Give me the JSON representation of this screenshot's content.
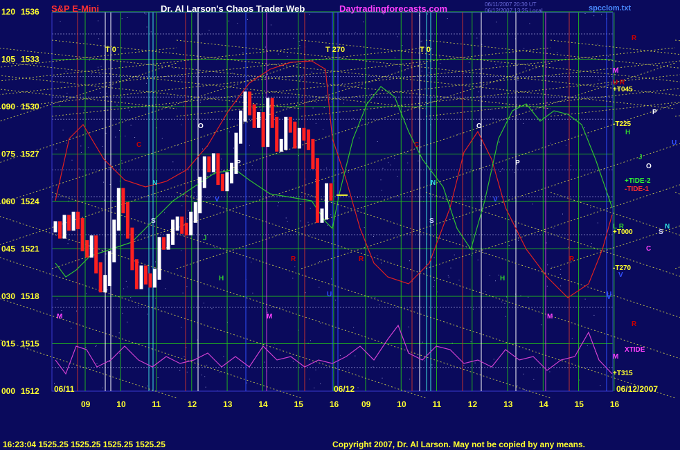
{
  "header": {
    "symbol": "S&P E-Mini",
    "title": "Dr. Al Larson's Chaos Trader Web",
    "website": "Daytradingforecasts.com",
    "timestamp_1": "06/11/2007 20:30 UT",
    "timestamp_2": "06/12/2007 13:25 Local",
    "filename": "spcclom.txt"
  },
  "footer": {
    "quote": "16:23:04  1525.25 1525.25 1525.25 1525.25",
    "copyright": "Copyright 2007, Dr. Al Larson. May not be copied by any means."
  },
  "colors": {
    "background": "#0a0a5c",
    "price_up": "#ffffff",
    "price_down": "#ff2020",
    "grid_green": "#20b020",
    "grid_yellow": "#e8e84a",
    "red_wave": "#e02020",
    "green_wave": "#30c030",
    "magenta_wave": "#d040d0",
    "title_red": "#ff3030",
    "title_white": "#ffffff",
    "title_magenta": "#ff40ff",
    "axis_yellow": "#ffff30"
  },
  "chart_data": {
    "type": "line",
    "y_axis_labels": [
      {
        "left": "120",
        "right": "1536"
      },
      {
        "left": "105",
        "right": "1533"
      },
      {
        "left": "090",
        "right": "1530"
      },
      {
        "left": "075",
        "right": "1527"
      },
      {
        "left": "060",
        "right": "1524"
      },
      {
        "left": "045",
        "right": "1521"
      },
      {
        "left": "030",
        "right": "1518"
      },
      {
        "left": "015",
        "right": "1515"
      },
      {
        "left": "000",
        "right": "1512"
      }
    ],
    "ylim": [
      1512,
      1536
    ],
    "x_hour_ticks": [
      "09",
      "10",
      "11",
      "12",
      "13",
      "14",
      "15",
      "16",
      "09",
      "10",
      "11",
      "12",
      "13",
      "14",
      "15",
      "16"
    ],
    "date_labels": {
      "day1": "06/11",
      "day2": "06/12",
      "end": "06/12/2007"
    },
    "time_markers": [
      "T 0",
      "T 270",
      "T 0"
    ],
    "right_labels": [
      {
        "text": "R",
        "color": "#cc0000"
      },
      {
        "text": "M",
        "color": "#ff40ff"
      },
      {
        "text": "U R",
        "color": "#cc0000"
      },
      {
        "text": "+T045",
        "color": "#ffff30"
      },
      {
        "text": "P",
        "color": "#ffffff"
      },
      {
        "text": "-T225",
        "color": "#ffff30"
      },
      {
        "text": "H",
        "color": "#30d030"
      },
      {
        "text": "U",
        "color": "#3050ff"
      },
      {
        "text": "J",
        "color": "#30d030"
      },
      {
        "text": "O",
        "color": "#ffffff"
      },
      {
        "text": "+TIDE-2",
        "color": "#30ff30"
      },
      {
        "text": "-TIDE-1",
        "color": "#ff3030"
      },
      {
        "text": "L R",
        "color": "#30d030"
      },
      {
        "text": "+T000",
        "color": "#ffff30"
      },
      {
        "text": "S",
        "color": "#d0d0ff"
      },
      {
        "text": "N",
        "color": "#30e0e0"
      },
      {
        "text": "C",
        "color": "#ff40ff"
      },
      {
        "text": "-T270",
        "color": "#ffff30"
      },
      {
        "text": "V",
        "color": "#3050ff"
      },
      {
        "text": "V",
        "color": "#3050ff"
      },
      {
        "text": "R",
        "color": "#cc0000"
      },
      {
        "text": "XTIDE",
        "color": "#ff40ff"
      },
      {
        "text": "M",
        "color": "#ff40ff"
      },
      {
        "text": "+T315",
        "color": "#ffff30"
      }
    ],
    "planet_marks": [
      {
        "text": "M",
        "color": "#ff40ff"
      },
      {
        "text": "M",
        "color": "#ff40ff"
      },
      {
        "text": "M",
        "color": "#ff40ff"
      },
      {
        "text": "N",
        "color": "#30e0e0"
      },
      {
        "text": "N",
        "color": "#30e0e0"
      },
      {
        "text": "C",
        "color": "#cc0000"
      },
      {
        "text": "C",
        "color": "#cc0000"
      },
      {
        "text": "O",
        "color": "#ffffff"
      },
      {
        "text": "O",
        "color": "#ffffff"
      },
      {
        "text": "P",
        "color": "#ffffff"
      },
      {
        "text": "P",
        "color": "#ffffff"
      },
      {
        "text": "H",
        "color": "#30d030"
      },
      {
        "text": "H",
        "color": "#30d030"
      },
      {
        "text": "J",
        "color": "#30d030"
      },
      {
        "text": "S",
        "color": "#d0d0ff"
      },
      {
        "text": "S",
        "color": "#d0d0ff"
      },
      {
        "text": "R",
        "color": "#cc0000"
      },
      {
        "text": "R",
        "color": "#cc0000"
      },
      {
        "text": "R",
        "color": "#cc0000"
      },
      {
        "text": "V",
        "color": "#3050ff"
      },
      {
        "text": "V",
        "color": "#3050ff"
      },
      {
        "text": "U",
        "color": "#3050ff"
      },
      {
        "text": "U",
        "color": "#3050ff"
      }
    ],
    "price_series": {
      "name": "",
      "values": [
        1522.4,
        1522.0,
        1522.8,
        1522.5,
        1523.0,
        1522.6,
        1521.2,
        1520.8,
        1521.5,
        1519.8,
        1518.6,
        1519.0,
        1520.5,
        1522.5,
        1524.5,
        1523.6,
        1522.0,
        1520.0,
        1518.8,
        1519.6,
        1519.1,
        1518.9,
        1519.4,
        1521.4,
        1521.3,
        1521.6,
        1522.5,
        1522.7,
        1522.3,
        1522.2,
        1523.0,
        1523.6,
        1525.2,
        1526.5,
        1526.2,
        1526.7,
        1525.4,
        1525.0,
        1525.5,
        1526.1,
        1528.0,
        1529.4,
        1530.6,
        1529.8,
        1529.0,
        1529.3,
        1527.8,
        1530.2,
        1529.0,
        1527.5,
        1527.6,
        1529.0,
        1528.7,
        1527.7,
        1528.3,
        1528.2,
        1527.6,
        1526.4,
        1523.0,
        1523.2,
        1524.8,
        1524.4
      ],
      "ylim": [
        1512,
        1536
      ]
    }
  }
}
